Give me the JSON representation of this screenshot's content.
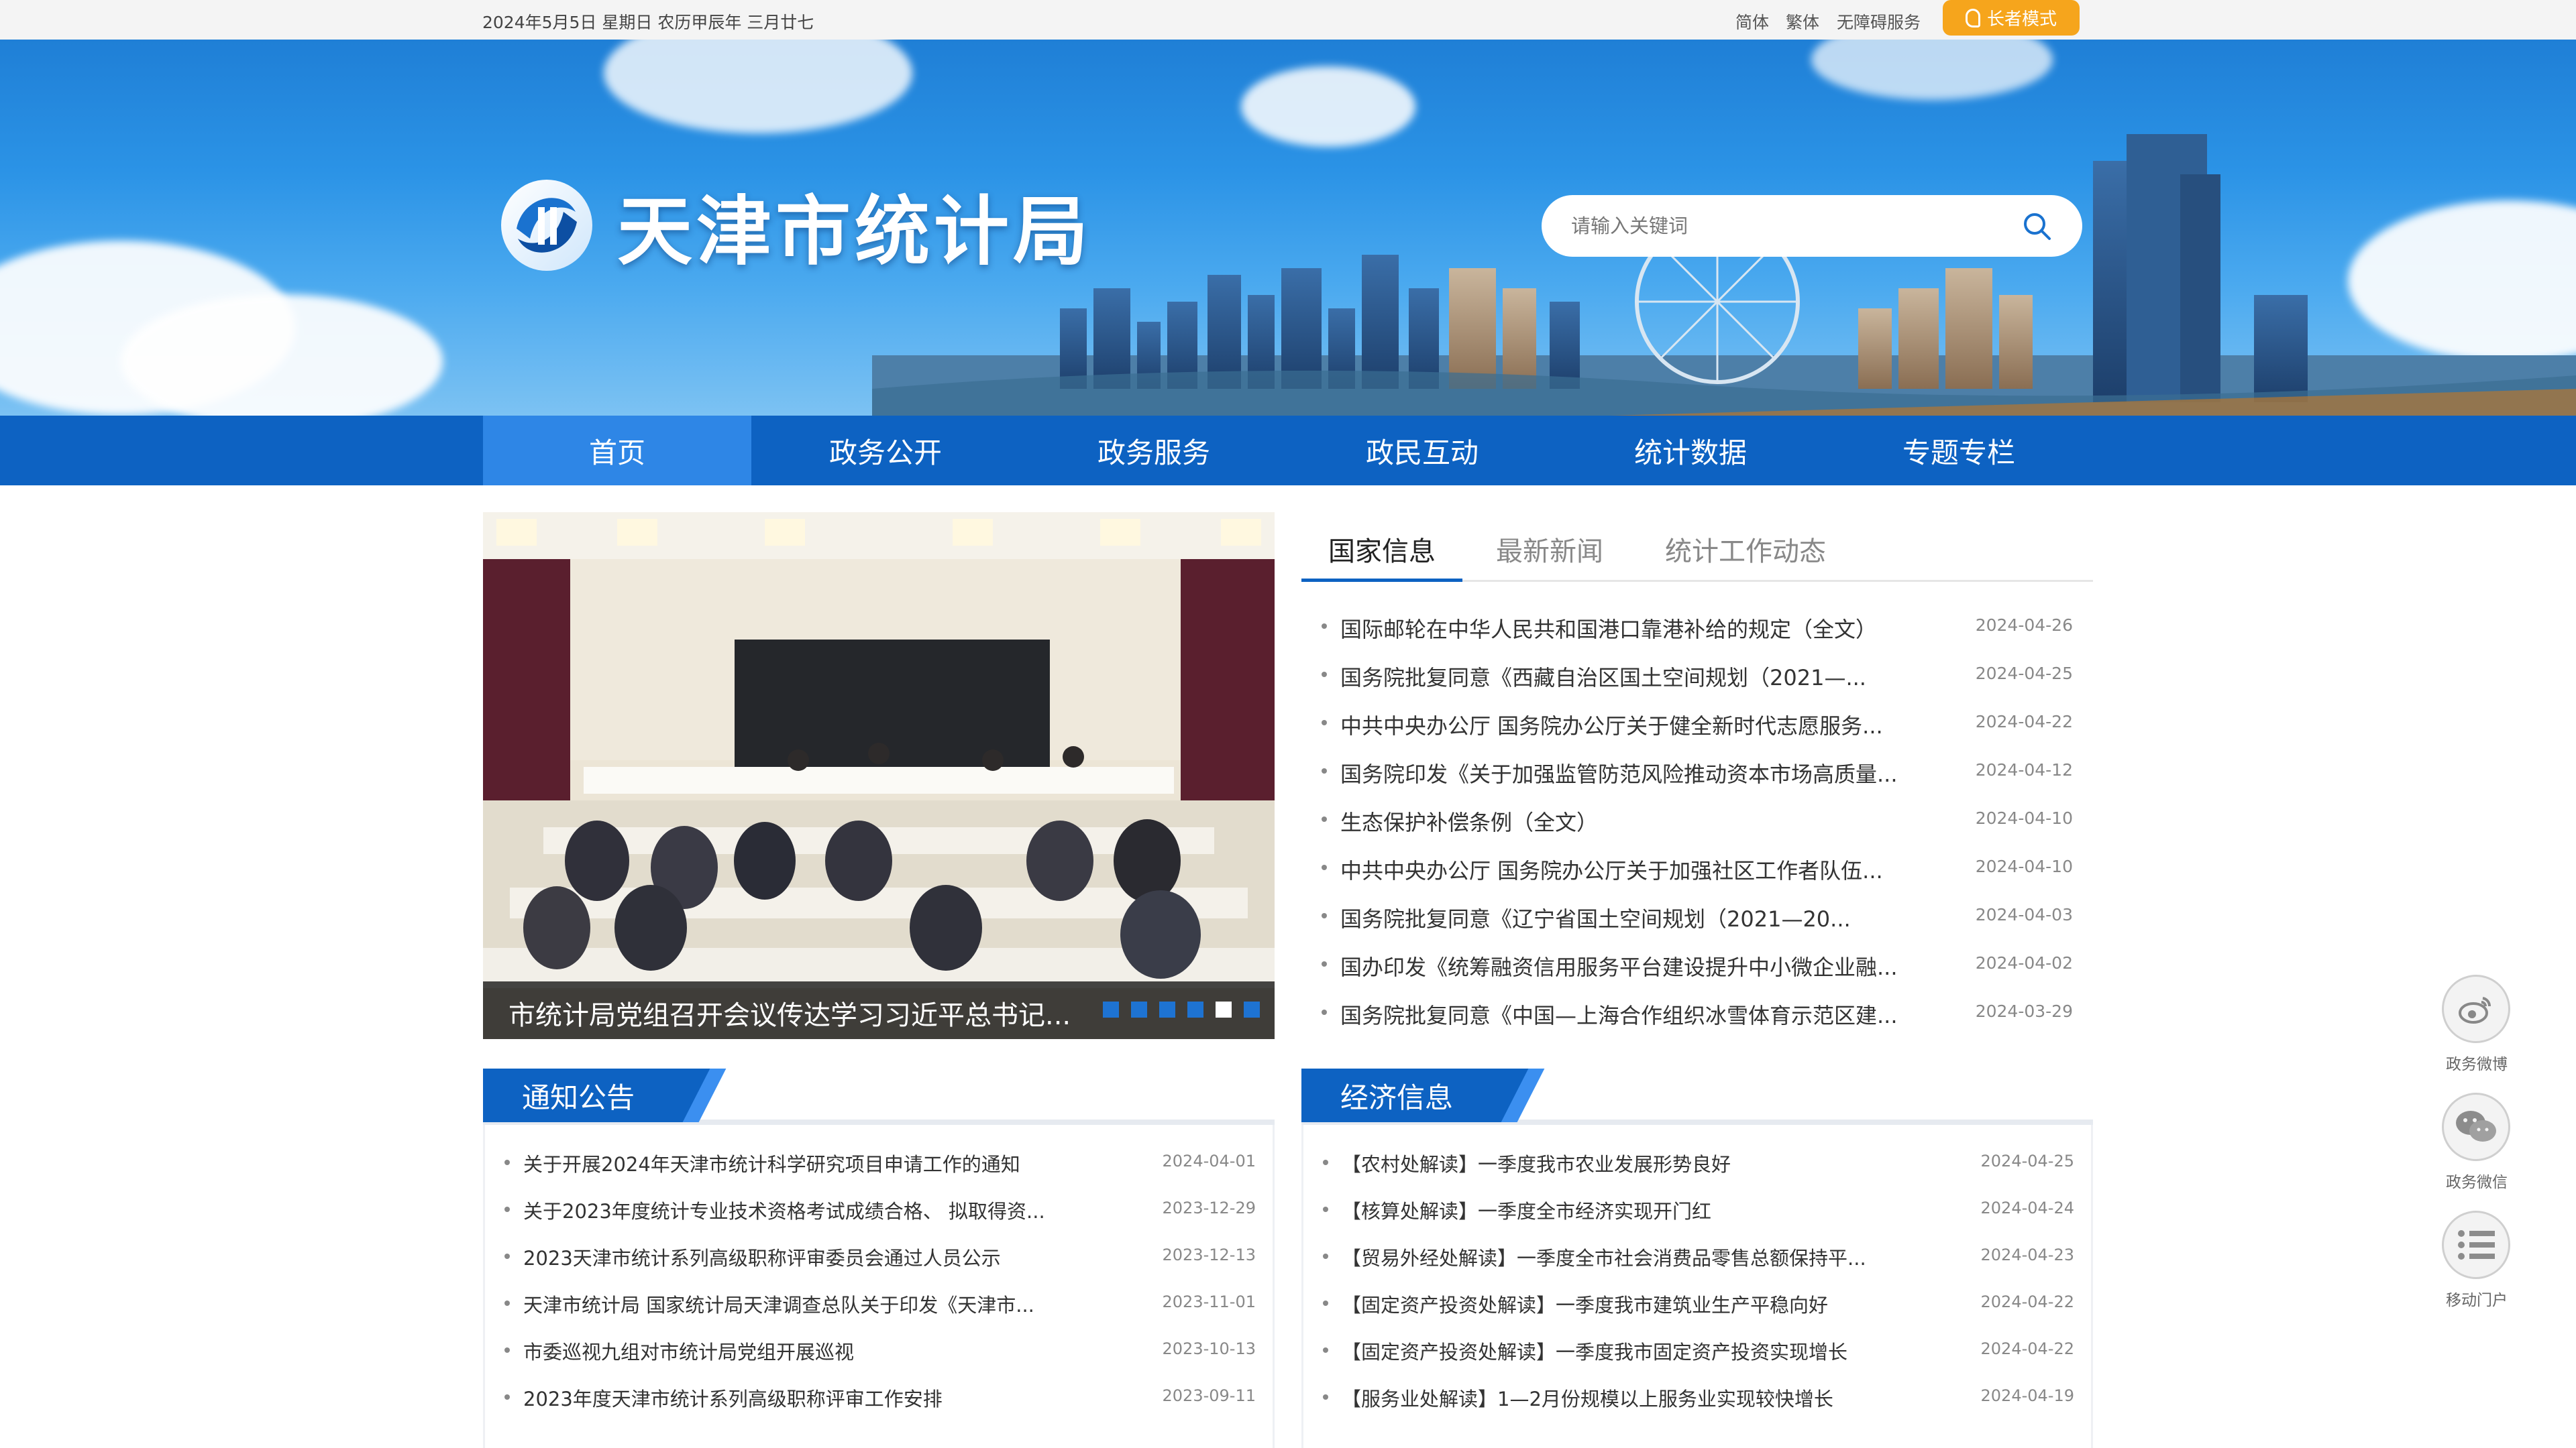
{
  "topbar": {
    "date": "2024年5月5日 星期日 农历甲辰年 三月廿七",
    "simplified": "简体",
    "traditional": "繁体",
    "accessibility": "无障碍服务",
    "elder_mode": "长者模式"
  },
  "header": {
    "title": "天津市统计局",
    "search_placeholder": "请输入关键词"
  },
  "nav": {
    "items": [
      "首页",
      "政务公开",
      "政务服务",
      "政民互动",
      "统计数据",
      "专题专栏"
    ]
  },
  "carousel": {
    "caption": "市统计局党组召开会议传达学习习近平总书记...",
    "dots_total": 6,
    "active_dot": 5
  },
  "news": {
    "tabs": [
      "国家信息",
      "最新新闻",
      "统计工作动态"
    ],
    "items": [
      {
        "title": "国际邮轮在中华人民共和国港口靠港补给的规定（全文）",
        "date": "2024-04-26"
      },
      {
        "title": "国务院批复同意《西藏自治区国土空间规划（2021—...",
        "date": "2024-04-25"
      },
      {
        "title": "中共中央办公厅 国务院办公厅关于健全新时代志愿服务...",
        "date": "2024-04-22"
      },
      {
        "title": "国务院印发《关于加强监管防范风险推动资本市场高质量...",
        "date": "2024-04-12"
      },
      {
        "title": "生态保护补偿条例（全文）",
        "date": "2024-04-10"
      },
      {
        "title": "中共中央办公厅  国务院办公厅关于加强社区工作者队伍...",
        "date": "2024-04-10"
      },
      {
        "title": "国务院批复同意《辽宁省国土空间规划（2021—20...",
        "date": "2024-04-03"
      },
      {
        "title": "国办印发《统筹融资信用服务平台建设提升中小微企业融...",
        "date": "2024-04-02"
      },
      {
        "title": "国务院批复同意《中国—上海合作组织冰雪体育示范区建...",
        "date": "2024-03-29"
      }
    ]
  },
  "notices": {
    "heading": "通知公告",
    "items": [
      {
        "title": "关于开展2024年天津市统计科学研究项目申请工作的通知",
        "date": "2024-04-01"
      },
      {
        "title": "关于2023年度统计专业技术资格考试成绩合格、 拟取得资...",
        "date": "2023-12-29"
      },
      {
        "title": "2023天津市统计系列高级职称评审委员会通过人员公示",
        "date": "2023-12-13"
      },
      {
        "title": "天津市统计局 国家统计局天津调查总队关于印发《天津市...",
        "date": "2023-11-01"
      },
      {
        "title": "市委巡视九组对市统计局党组开展巡视",
        "date": "2023-10-13"
      },
      {
        "title": "2023年度天津市统计系列高级职称评审工作安排",
        "date": "2023-09-11"
      }
    ]
  },
  "economy": {
    "heading": "经济信息",
    "items": [
      {
        "title": "【农村处解读】一季度我市农业发展形势良好",
        "date": "2024-04-25"
      },
      {
        "title": "【核算处解读】一季度全市经济实现开门红",
        "date": "2024-04-24"
      },
      {
        "title": "【贸易外经处解读】一季度全市社会消费品零售总额保持平...",
        "date": "2024-04-23"
      },
      {
        "title": "【固定资产投资处解读】一季度我市建筑业生产平稳向好",
        "date": "2024-04-22"
      },
      {
        "title": "【固定资产投资处解读】一季度我市固定资产投资实现增长",
        "date": "2024-04-22"
      },
      {
        "title": "【服务业处解读】1—2月份规模以上服务业实现较快增长",
        "date": "2024-04-19"
      }
    ]
  },
  "floating": {
    "weibo": "政务微博",
    "wechat": "政务微信",
    "mobile": "移动门户"
  },
  "colors": {
    "primary": "#0d62c2",
    "nav_active": "#2e86e6",
    "elder_button": "#f6a51c"
  },
  "icons": [
    "ear-icon",
    "search-icon",
    "weibo-icon",
    "wechat-icon",
    "list-icon",
    "logo-icon"
  ]
}
